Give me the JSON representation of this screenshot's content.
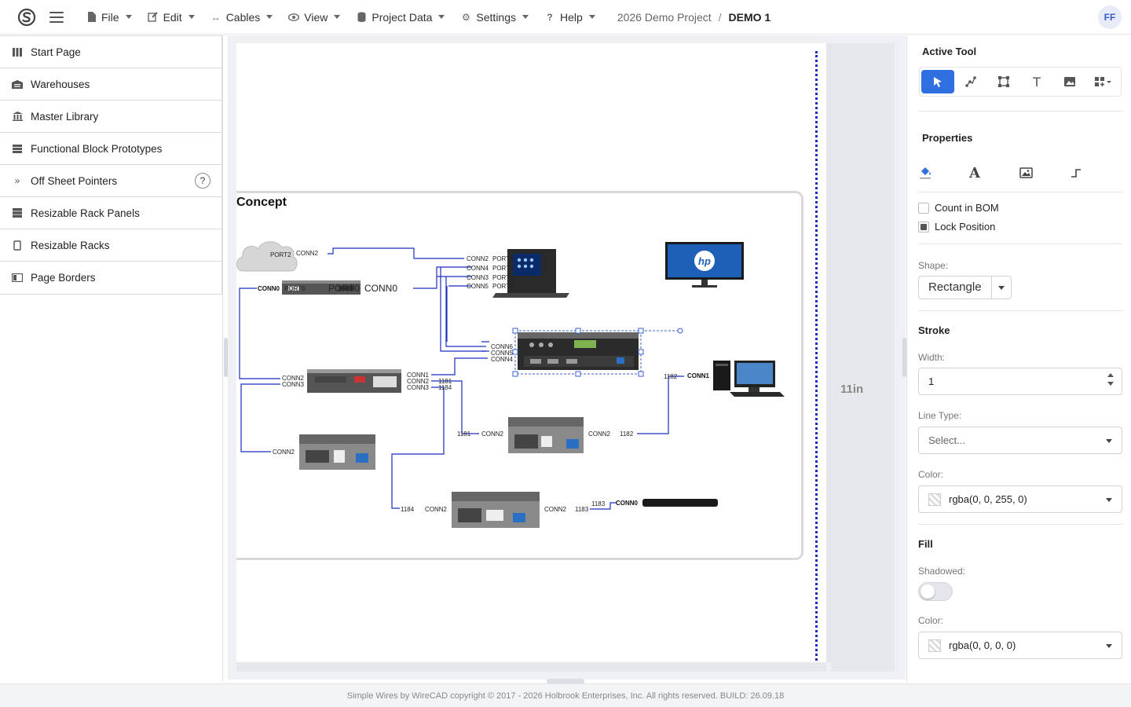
{
  "topbar": {
    "menus": [
      {
        "label": "File",
        "icon": "file-icon"
      },
      {
        "label": "Edit",
        "icon": "edit-icon"
      },
      {
        "label": "Cables",
        "icon": "cables-icon"
      },
      {
        "label": "View",
        "icon": "eye-icon"
      },
      {
        "label": "Project Data",
        "icon": "database-icon"
      },
      {
        "label": "Settings",
        "icon": "gear-icon"
      },
      {
        "label": "Help",
        "icon": "question-icon"
      }
    ],
    "breadcrumb": {
      "project": "2026 Demo Project",
      "separator": "/",
      "page": "DEMO 1"
    },
    "avatar": "FF"
  },
  "sidebar": {
    "items": [
      {
        "label": "Start Page",
        "icon": "columns-icon"
      },
      {
        "label": "Warehouses",
        "icon": "warehouse-icon"
      },
      {
        "label": "Master Library",
        "icon": "library-icon"
      },
      {
        "label": "Functional Block Prototypes",
        "icon": "blocks-icon"
      },
      {
        "label": "Off Sheet Pointers",
        "icon": "double-chevron-icon",
        "help": "?"
      },
      {
        "label": "Resizable Rack Panels",
        "icon": "rack-panels-icon"
      },
      {
        "label": "Resizable Racks",
        "icon": "rack-icon"
      },
      {
        "label": "Page Borders",
        "icon": "page-border-icon"
      }
    ]
  },
  "canvas": {
    "concept_title": "Concept",
    "dimension_label": "11in",
    "labels": {
      "port2_cloud": "PORT2",
      "conn2_top": "CONN2",
      "conn0_a": "CONN0",
      "port0_a": "PORT0",
      "port0_b": "PORT0",
      "conn0_b": "CONN0",
      "conn2_l": "CONN2",
      "port2_l": "PORT2",
      "conn4_l": "CONN4",
      "port4_l": "PORT4",
      "conn3_l": "CONN3",
      "port3_l": "PORT3",
      "conn5_l": "CONN5",
      "port5_l": "PORT5",
      "conn6": "CONN6",
      "conn5": "CONN5",
      "conn4": "CONN4",
      "conn2_m": "CONN2",
      "conn3_m": "CONN3",
      "conn1_m": "CONN1",
      "conn2_m2": "CONN2",
      "conn3_m2": "CONN3",
      "n1181_a": "1181",
      "n1184_a": "1184",
      "n1182_a": "1182",
      "conn1_pc": "CONN1",
      "conn2_box": "CONN2",
      "n1181_b": "1181",
      "conn2_c": "CONN2",
      "conn2_d": "CONN2",
      "n1182_b": "1182",
      "n1184_b": "1184",
      "conn2_e": "CONN2",
      "conn2_f": "CONN2",
      "n1183_a": "1183",
      "n1183_b": "1183",
      "conn0_c": "CONN0"
    }
  },
  "panel": {
    "active_tool_title": "Active Tool",
    "tools": [
      "pointer-icon",
      "node-path-icon",
      "bounding-box-icon",
      "text-tool-icon",
      "image-tool-icon",
      "add-shape-icon"
    ],
    "properties_title": "Properties",
    "prop_tabs": [
      "paint-bucket-icon",
      "font-icon",
      "image-icon",
      "connector-icon"
    ],
    "count_in_bom": {
      "label": "Count in BOM",
      "checked": false
    },
    "lock_position": {
      "label": "Lock Position",
      "checked": true
    },
    "shape_label": "Shape:",
    "shape_value": "Rectangle",
    "stroke_title": "Stroke",
    "width_label": "Width:",
    "width_value": "1",
    "line_type_label": "Line Type:",
    "line_type_placeholder": "Select...",
    "stroke_color_label": "Color:",
    "stroke_color_value": "rgba(0, 0, 255, 0)",
    "fill_title": "Fill",
    "shadowed_label": "Shadowed:",
    "shadowed": false,
    "fill_color_label": "Color:",
    "fill_color_value": "rgba(0, 0, 0, 0)"
  },
  "footer": "Simple Wires by WireCAD copyright © 2017 - 2026 Holbrook Enterprises, Inc. All rights reserved. BUILD: 26.09.18",
  "colors": {
    "accent": "#2f6fe0",
    "wire": "#1a2fc0",
    "selection": "#3a5fcf"
  }
}
